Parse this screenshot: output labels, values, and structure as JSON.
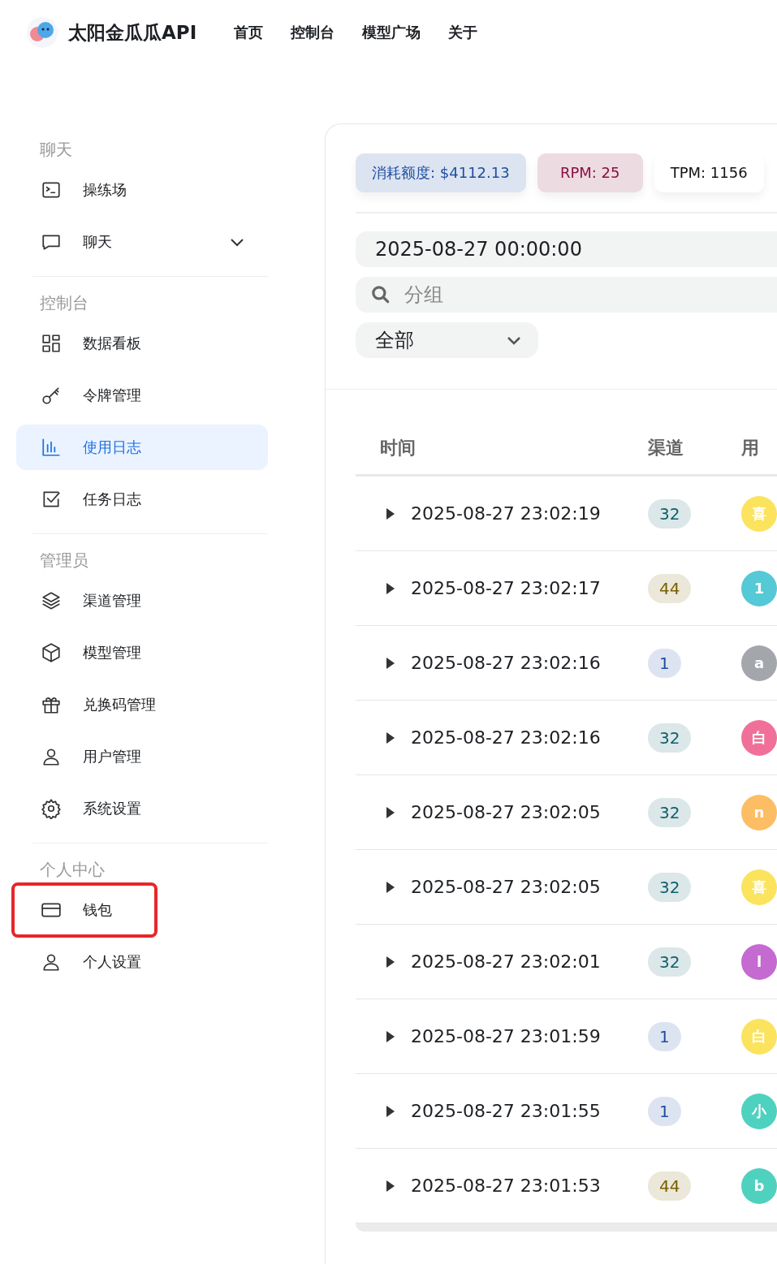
{
  "header": {
    "brand": "太阳金瓜瓜API",
    "nav": [
      {
        "label": "首页"
      },
      {
        "label": "控制台"
      },
      {
        "label": "模型广场"
      },
      {
        "label": "关于"
      }
    ]
  },
  "sidebar": {
    "sections": [
      {
        "title": "聊天",
        "items": [
          {
            "label": "操练场",
            "selected": false,
            "highlighted": false
          },
          {
            "label": "聊天",
            "selected": false,
            "highlighted": false,
            "expanded": false
          }
        ]
      },
      {
        "title": "控制台",
        "items": [
          {
            "label": "数据看板",
            "selected": false,
            "highlighted": false
          },
          {
            "label": "令牌管理",
            "selected": false,
            "highlighted": false
          },
          {
            "label": "使用日志",
            "selected": true,
            "highlighted": false
          },
          {
            "label": "任务日志",
            "selected": false,
            "highlighted": false
          }
        ]
      },
      {
        "title": "管理员",
        "items": [
          {
            "label": "渠道管理",
            "selected": false,
            "highlighted": false
          },
          {
            "label": "模型管理",
            "selected": false,
            "highlighted": false
          },
          {
            "label": "兑换码管理",
            "selected": false,
            "highlighted": false
          },
          {
            "label": "用户管理",
            "selected": false,
            "highlighted": false
          },
          {
            "label": "系统设置",
            "selected": false,
            "highlighted": false
          }
        ]
      },
      {
        "title": "个人中心",
        "items": [
          {
            "label": "钱包",
            "selected": false,
            "highlighted": true
          },
          {
            "label": "个人设置",
            "selected": false,
            "highlighted": false
          }
        ]
      }
    ]
  },
  "stats": [
    {
      "text": "消耗额度: $4112.13",
      "color": "#1d4ea0"
    },
    {
      "text": "RPM: 25",
      "color": "#8a1040"
    },
    {
      "text": "TPM: 1156",
      "color": "#111111"
    }
  ],
  "filters": {
    "date_value": "2025-08-27 00:00:00",
    "group_placeholder": "分组",
    "select_value": "全部"
  },
  "table": {
    "columns": [
      "时间",
      "渠道",
      "用"
    ],
    "rows": [
      {
        "time": "2025-08-27 23:02:19",
        "channel": {
          "text": "32",
          "color": "#0f5e6b"
        },
        "user": {
          "text": "喜",
          "color": "#fbe35e"
        }
      },
      {
        "time": "2025-08-27 23:02:17",
        "channel": {
          "text": "44",
          "color": "#7a5f00"
        },
        "user": {
          "text": "1",
          "color": "#55c9d5"
        }
      },
      {
        "time": "2025-08-27 23:02:16",
        "channel": {
          "text": "1",
          "color": "#1d4ea0"
        },
        "user": {
          "text": "a",
          "color": "#a3a6ab"
        }
      },
      {
        "time": "2025-08-27 23:02:16",
        "channel": {
          "text": "32",
          "color": "#0f5e6b"
        },
        "user": {
          "text": "白",
          "color": "#f0709a"
        }
      },
      {
        "time": "2025-08-27 23:02:05",
        "channel": {
          "text": "32",
          "color": "#0f5e6b"
        },
        "user": {
          "text": "n",
          "color": "#fdbd64"
        }
      },
      {
        "time": "2025-08-27 23:02:05",
        "channel": {
          "text": "32",
          "color": "#0f5e6b"
        },
        "user": {
          "text": "喜",
          "color": "#fbe35e"
        }
      },
      {
        "time": "2025-08-27 23:02:01",
        "channel": {
          "text": "32",
          "color": "#0f5e6b"
        },
        "user": {
          "text": "l",
          "color": "#c46ad0"
        }
      },
      {
        "time": "2025-08-27 23:01:59",
        "channel": {
          "text": "1",
          "color": "#1d4ea0"
        },
        "user": {
          "text": "白",
          "color": "#fbe35e"
        }
      },
      {
        "time": "2025-08-27 23:01:55",
        "channel": {
          "text": "1",
          "color": "#1d4ea0"
        },
        "user": {
          "text": "小",
          "color": "#4fd1c0"
        }
      },
      {
        "time": "2025-08-27 23:01:53",
        "channel": {
          "text": "44",
          "color": "#7a5f00"
        },
        "user": {
          "text": "b",
          "color": "#4fd1c0"
        }
      }
    ]
  }
}
